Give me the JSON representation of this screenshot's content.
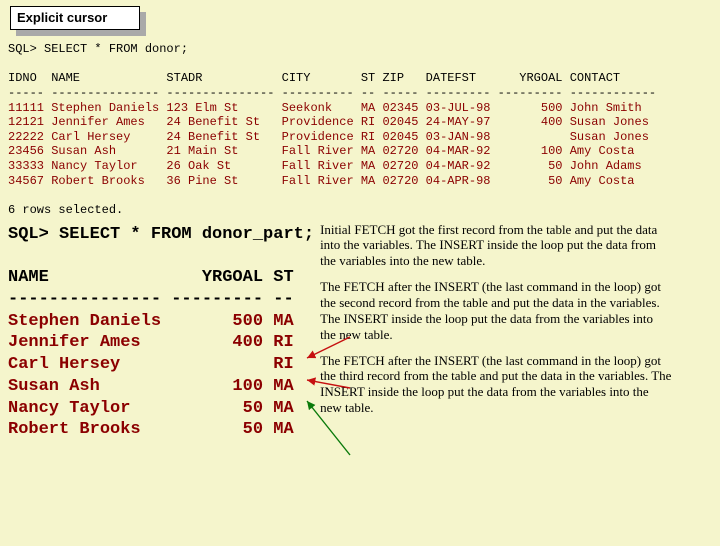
{
  "title": "Explicit cursor",
  "sql1_prompt": "SQL> SELECT * FROM donor;",
  "table1": {
    "heading": "IDNO  NAME            STADR           CITY       ST ZIP   DATEFST      YRGOAL CONTACT",
    "dashes": "----- --------------- --------------- ---------- -- ----- --------- --------- ------------",
    "rows": [
      "11111 Stephen Daniels 123 Elm St      Seekonk    MA 02345 03-JUL-98       500 John Smith",
      "12121 Jennifer Ames   24 Benefit St   Providence RI 02045 24-MAY-97       400 Susan Jones",
      "22222 Carl Hersey     24 Benefit St   Providence RI 02045 03-JAN-98           Susan Jones",
      "23456 Susan Ash       21 Main St      Fall River MA 02720 04-MAR-92       100 Amy Costa",
      "33333 Nancy Taylor    26 Oak St       Fall River MA 02720 04-MAR-92        50 John Adams",
      "34567 Robert Brooks   36 Pine St      Fall River MA 02720 04-APR-98        50 Amy Costa"
    ]
  },
  "rows_msg": "6 rows selected.",
  "sql2_prompt": "SQL> SELECT * FROM donor_part;",
  "table2": {
    "heading": "NAME               YRGOAL ST",
    "dashes": "--------------- --------- --",
    "rows": [
      "Stephen Daniels       500 MA",
      "Jennifer Ames         400 RI",
      "Carl Hersey               RI",
      "Susan Ash             100 MA",
      "Nancy Taylor           50 MA",
      "Robert Brooks          50 MA"
    ]
  },
  "explanations": {
    "p1": "Initial FETCH got the first record from the table and put the data into the variables.  The INSERT inside the loop put the data from the variables into the new table.",
    "p2": "The FETCH after the INSERT (the last command in the loop) got the second record from the table and put the data in the variables.  The INSERT inside the loop put the data from the variables into the new table.",
    "p3": "The FETCH after the INSERT (the last command in the loop) got the third record from the table and put the data in the variables.  The INSERT inside the loop put the data from the variables into the new table."
  }
}
